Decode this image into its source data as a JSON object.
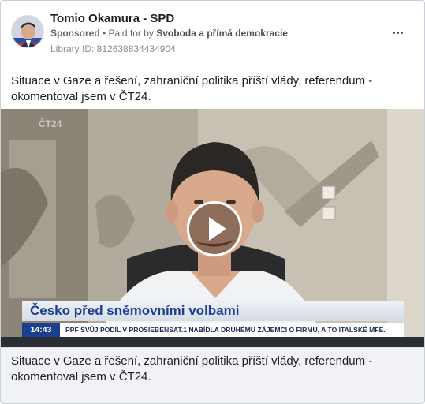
{
  "post": {
    "page_name": "Tomio Okamura - SPD",
    "sponsored_label": "Sponsored",
    "separator": " • ",
    "paid_prefix": "Paid for by ",
    "paid_by": "Svoboda a přímá demokracie",
    "library_id": "Library ID: 812638834434904",
    "ad_text": "Situace v Gaze a řešení, zahraniční politika příští vlády, referendum - okomentoval jsem v ČT24.",
    "more_icon": "more-horizontal-icon"
  },
  "video": {
    "channel_logo": "ČT24",
    "lower_third_title": "Česko před sněmovními volbami",
    "ticker_time": "14:43",
    "ticker_text": "PPF SVŮJ PODÍL V PROSIEBENSAT.1 NABÍDLA DRUHÉMU ZÁJEMCI O FIRMU, A TO ITALSKÉ MFE.",
    "play_icon": "play-icon"
  },
  "caption": {
    "text": "Situace v Gaze a řešení, zahraniční politika příští vlády, referendum - okomentoval jsem v ČT24."
  }
}
